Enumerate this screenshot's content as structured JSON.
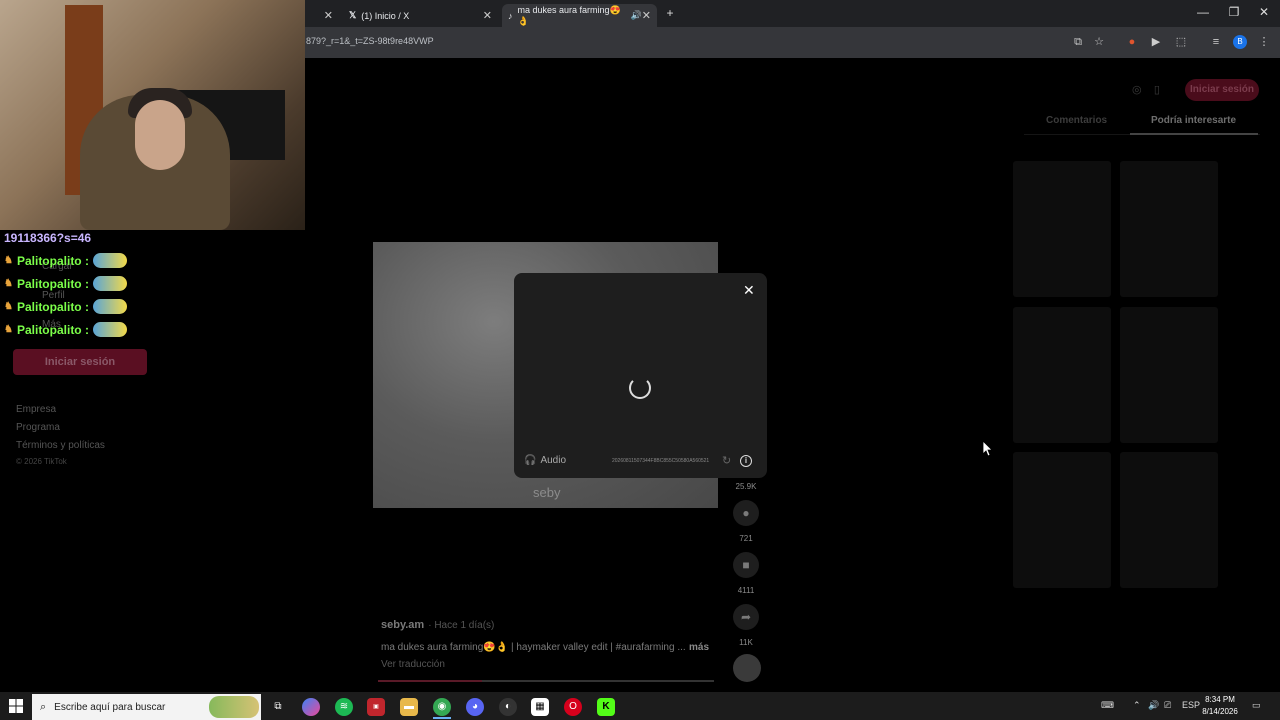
{
  "browser": {
    "tabs": [
      {
        "title": "(1) Inicio / X",
        "active": false
      },
      {
        "title": "ma dukes aura farming😍👌",
        "active": true
      }
    ],
    "url": "879?_r=1&_t=ZS-98t9re48VWP",
    "profile_initial": "B"
  },
  "overlay": {
    "chat_header": "19118366?s=46",
    "chat_lines": [
      {
        "user": "Palitopalito :"
      },
      {
        "user": "Palitopalito :"
      },
      {
        "user": "Palitopalito :"
      },
      {
        "user": "Palitopalito :"
      }
    ]
  },
  "sidebar": {
    "dim_items": [
      "Cargar",
      "Perfil",
      "Más"
    ],
    "login_label": "Iniciar sesión",
    "footer": [
      "Empresa",
      "Programa",
      "Términos y políticas",
      "© 2026 TikTok"
    ]
  },
  "video": {
    "watermark": "seby",
    "counts": {
      "likes": "25.9K",
      "comments": "721",
      "saves": "4111",
      "shares": "11K"
    },
    "author": "seby.am",
    "time": "· Hace 1 día(s)",
    "caption": "ma dukes aura farming😍👌 | haymaker valley edit | #aurafarming ...",
    "more": "más",
    "translate": "Ver traducción",
    "progress": 0.31
  },
  "right_panel": {
    "login_label": "Iniciar sesión",
    "tabs": [
      "Comentarios",
      "Podría interesarte"
    ],
    "active_tab": "Podría interesarte"
  },
  "modal": {
    "audio_label": "Audio",
    "hash": "20260811507344F8BC855C50580A560521"
  },
  "taskbar": {
    "search_placeholder": "Escribe aquí para buscar",
    "lang": "ESP",
    "time": "8:34 PM",
    "date": "8/14/2026"
  }
}
